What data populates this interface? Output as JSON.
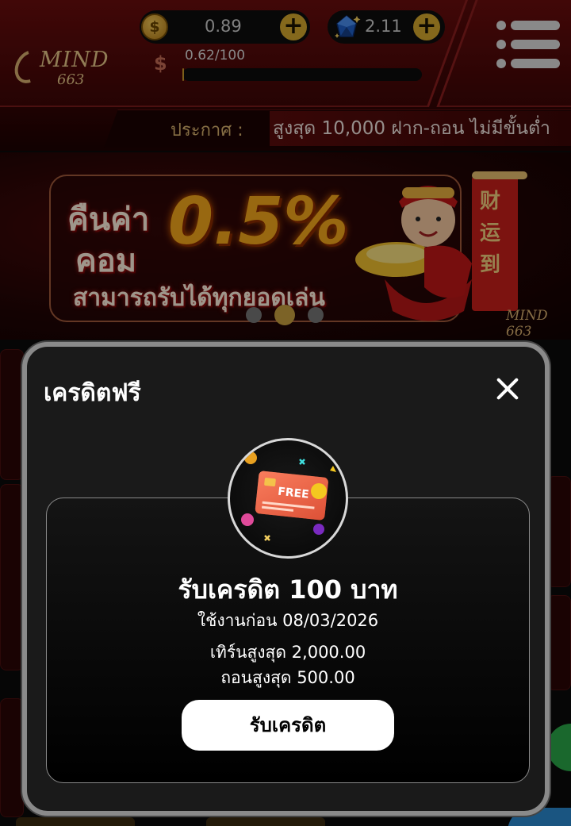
{
  "header": {
    "logo_text": "MIND",
    "logo_number": "663",
    "coins": {
      "value": "0.89",
      "plus_label": "+"
    },
    "gems": {
      "value": "2.11",
      "plus_label": "+"
    },
    "progress": {
      "text": "0.62/100",
      "fraction": 0.0062
    },
    "announcement": {
      "label": "ประกาศ :",
      "text": "สูงสุด 10,000 ฝาก-ถอน ไม่มีขั้นต่ำ"
    }
  },
  "banner": {
    "line1": "คืนค่า",
    "line2": "คอม",
    "percent": "0.5%",
    "line3": "สามารถรับได้ทุกยอดเล่น",
    "flag_text": "财运到",
    "logo_text": "MIND 663",
    "active_dot": 1,
    "dot_count": 3
  },
  "modal": {
    "title": "เครดิตฟรี",
    "badge_text": "FREE",
    "reward_title": "รับเครดิต 100 บาท",
    "expire": "ใช้งานก่อน 08/03/2026",
    "turnover": "เทิร์นสูงสุด 2,000.00",
    "withdraw": "ถอนสูงสุด 500.00",
    "claim_label": "รับเครดิต"
  },
  "colors": {
    "accent_gold": "#d6a92e",
    "header_red": "#5a0a0a",
    "modal_bg": "#1a1a1a"
  }
}
